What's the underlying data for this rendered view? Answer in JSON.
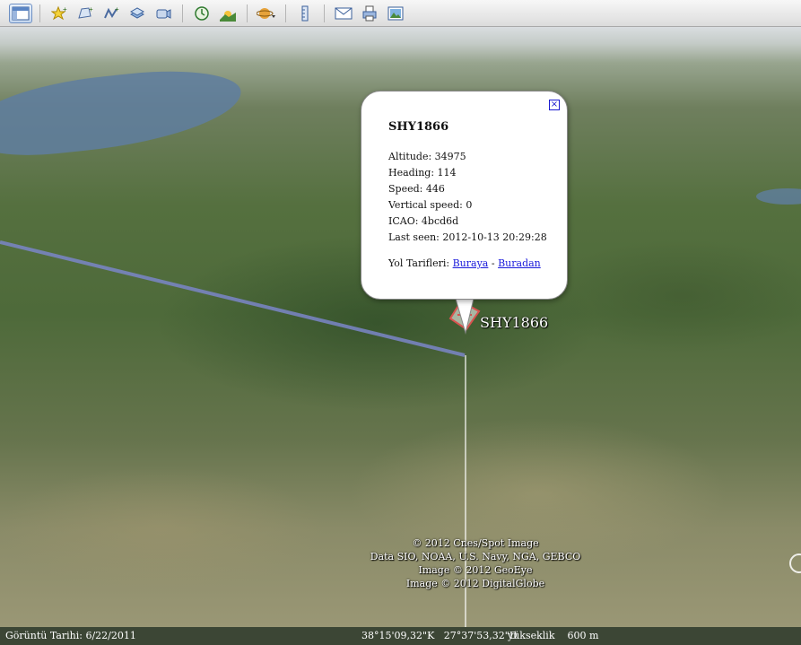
{
  "toolbar": {
    "buttons": [
      {
        "icon": "sidebar-icon"
      },
      {
        "icon": "add-placemark-icon"
      },
      {
        "icon": "add-polygon-icon"
      },
      {
        "icon": "add-path-icon"
      },
      {
        "icon": "add-image-overlay-icon"
      },
      {
        "icon": "record-tour-icon"
      },
      {
        "icon": "historical-imagery-icon"
      },
      {
        "icon": "sunlight-icon"
      },
      {
        "icon": "planets-icon"
      },
      {
        "icon": "ruler-icon"
      },
      {
        "icon": "email-icon"
      },
      {
        "icon": "print-icon"
      },
      {
        "icon": "save-image-icon"
      }
    ]
  },
  "placemark": {
    "label": "SHY1866"
  },
  "balloon": {
    "title": "SHY1866",
    "close_glyph": "×",
    "rows": [
      "Altitude: 34975",
      "Heading: 114",
      "Speed: 446",
      "Vertical speed: 0",
      "ICAO: 4bcd6d",
      "Last seen: 2012-10-13 20:29:28"
    ],
    "directions_label": "Yol Tarifleri:",
    "directions_to": "Buraya",
    "directions_sep": "-",
    "directions_from": "Buradan"
  },
  "attribution": [
    "© 2012 Cnes/Spot Image",
    "Data SIO, NOAA, U.S. Navy, NGA, GEBCO",
    "Image © 2012 GeoEye",
    "Image © 2012 DigitalGlobe"
  ],
  "statusbar": {
    "imagery_date": "Görüntü Tarihi: 6/22/2011",
    "coordinates": "38°15'09,32\"K   27°37'53,32\"D",
    "elevation": "yükseklik    600 m"
  },
  "colors": {
    "link": "#1a1adb",
    "track": "#7b86c8",
    "placemark": "#d9534f"
  }
}
